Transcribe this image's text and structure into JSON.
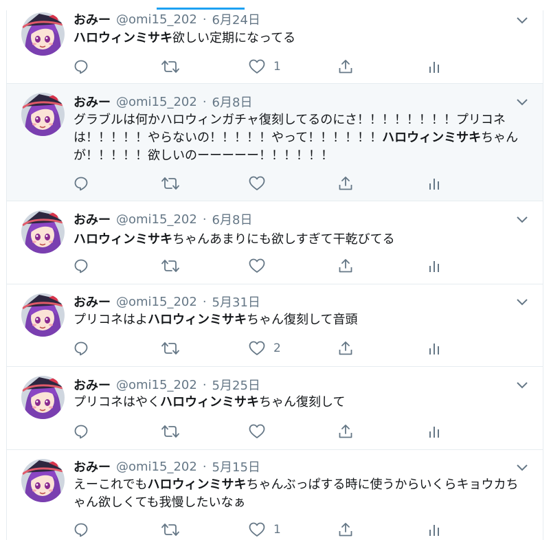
{
  "tweets": [
    {
      "name": "おみー",
      "handle": "@omi15_202",
      "sep": "·",
      "date": "6月24日",
      "before": "",
      "bold": "ハロウィンミサキ",
      "after": "欲しい定期になってる",
      "likes": "1"
    },
    {
      "name": "おみー",
      "handle": "@omi15_202",
      "sep": "·",
      "date": "6月8日",
      "before": "グラブルは何かハロウィンガチャ復刻してるのにさ！！！！！！！！プリコネは！！！！！やらないの！！！！！やって！！！！！！",
      "bold": "ハロウィンミサキ",
      "after": "ちゃんが！！！！！欲しいのーーーーー！！！！！！",
      "likes": ""
    },
    {
      "name": "おみー",
      "handle": "@omi15_202",
      "sep": "·",
      "date": "6月8日",
      "before": "",
      "bold": "ハロウィンミサキ",
      "after": "ちゃんあまりにも欲しすぎて干乾びてる",
      "likes": ""
    },
    {
      "name": "おみー",
      "handle": "@omi15_202",
      "sep": "·",
      "date": "5月31日",
      "before": "プリコネはよ",
      "bold": "ハロウィンミサキ",
      "after": "ちゃん復刻して音頭",
      "likes": "2"
    },
    {
      "name": "おみー",
      "handle": "@omi15_202",
      "sep": "·",
      "date": "5月25日",
      "before": "プリコネはやく",
      "bold": "ハロウィンミサキ",
      "after": "ちゃん復刻して",
      "likes": ""
    },
    {
      "name": "おみー",
      "handle": "@omi15_202",
      "sep": "·",
      "date": "5月15日",
      "before": "えーこれでも",
      "bold": "ハロウィンミサキ",
      "after": "ちゃんぶっぱする時に使うからいくらキョウカちゃん欲しくても我慢したいなぁ",
      "likes": "1"
    }
  ],
  "colors": {
    "accent": "#1da1f2",
    "muted": "#657786",
    "highlight_bg": "#f5f8fa",
    "border": "#e6ecf0"
  },
  "icons": {
    "reply": "reply-icon",
    "retweet": "retweet-icon",
    "like": "heart-icon",
    "share": "share-icon",
    "analytics": "analytics-icon",
    "caret": "chevron-down-icon"
  }
}
